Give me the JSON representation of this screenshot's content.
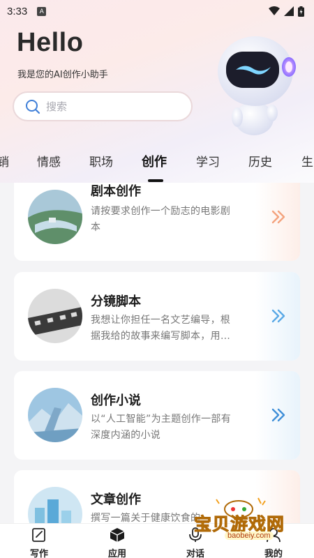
{
  "status_bar": {
    "time": "3:33",
    "badge": "A"
  },
  "header": {
    "greeting": "Hello",
    "subtitle": "我是您的AI创作小助手"
  },
  "search": {
    "placeholder": "搜索"
  },
  "tabs": [
    "销",
    "情感",
    "职场",
    "创作",
    "学习",
    "历史",
    "生"
  ],
  "active_tab": "创作",
  "cards": [
    {
      "title": "剧本创作",
      "desc_line1": "请按要求创作一个励志的电影剧",
      "desc_line2": "本"
    },
    {
      "title": "分镜脚本",
      "desc_line1": "我想让你担任一名文艺编导，根",
      "desc_line2": "据我给的故事来编写脚本，用…"
    },
    {
      "title": "创作小说",
      "desc_line1": "以“人工智能”为主题创作一部有",
      "desc_line2": "深度内涵的小说"
    },
    {
      "title": "文章创作",
      "desc_line1": "撰写一篇关于健康饮食的",
      "desc_line2": ""
    }
  ],
  "bottom_nav": [
    {
      "label": "写作",
      "icon": "edit-icon"
    },
    {
      "label": "应用",
      "icon": "cube-icon"
    },
    {
      "label": "对话",
      "icon": "microphone-icon"
    },
    {
      "label": "我的",
      "icon": "profile-icon"
    }
  ],
  "watermark": {
    "text": "宝贝游戏网",
    "url": "baobeiy.com"
  },
  "colors": {
    "accent_orange": "#f4a37e",
    "accent_blue": "#5aa9e6",
    "active_text": "#111111"
  }
}
